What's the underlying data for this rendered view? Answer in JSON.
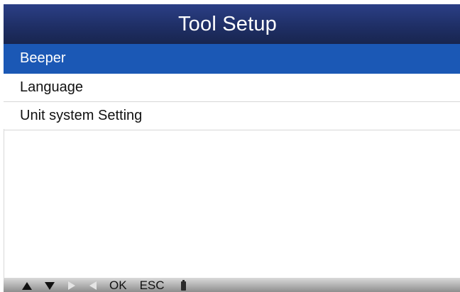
{
  "header": {
    "title": "Tool Setup"
  },
  "menu": {
    "selected_index": 0,
    "items": [
      {
        "label": "Beeper"
      },
      {
        "label": "Language"
      },
      {
        "label": "Unit system Setting"
      }
    ]
  },
  "status_bar": {
    "up_icon": "up-arrow-icon",
    "down_icon": "down-arrow-icon",
    "right_icon": "right-arrow-icon",
    "left_icon": "left-arrow-icon",
    "ok_label": "OK",
    "esc_label": "ESC",
    "battery_icon": "battery-icon"
  },
  "colors": {
    "title_bar": "#1f2f66",
    "selected_row": "#1b58b5",
    "status_bar": "#b8b8b8"
  }
}
